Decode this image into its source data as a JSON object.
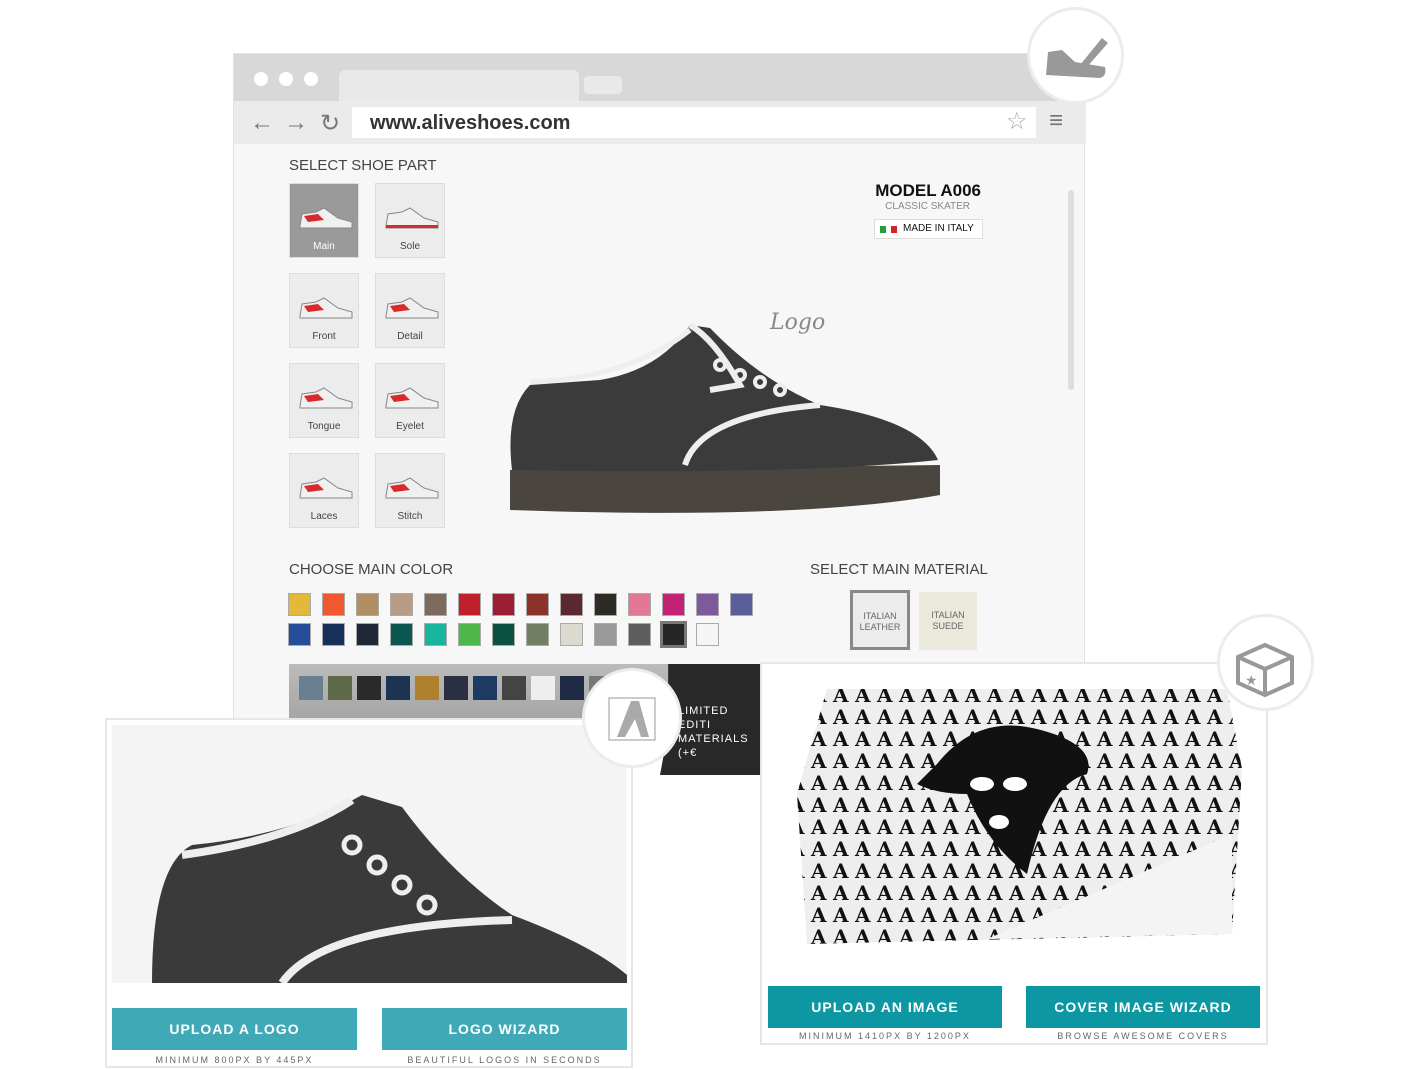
{
  "browser": {
    "url": "www.aliveshoes.com"
  },
  "shoe_parts": {
    "title": "SELECT SHOE PART",
    "items": [
      {
        "label": "Main",
        "selected": true
      },
      {
        "label": "Sole"
      },
      {
        "label": "Front"
      },
      {
        "label": "Detail"
      },
      {
        "label": "Tongue"
      },
      {
        "label": "Eyelet"
      },
      {
        "label": "Laces"
      },
      {
        "label": "Stitch"
      }
    ]
  },
  "model": {
    "title": "MODEL A006",
    "subtitle": "CLASSIC SKATER",
    "badge": "MADE IN ITALY"
  },
  "annotation": "Logo",
  "colors": {
    "title": "CHOOSE MAIN COLOR",
    "swatches": [
      "#e2b93a",
      "#f0592f",
      "#b08f64",
      "#b99c86",
      "#7e6a5c",
      "#c0202b",
      "#9a1f34",
      "#8c3228",
      "#5b2830",
      "#2e2b25",
      "#e07896",
      "#c22374",
      "#7e5a9a",
      "#5a5f9c",
      "#254d99",
      "#17305a",
      "#1f2837",
      "#0b5851",
      "#17b59d",
      "#4db74a",
      "#0b5040",
      "#727f63",
      "#dcd9cf",
      "#9a9a9a",
      "#5d5d5d",
      "#262626",
      "#f5f5f5"
    ],
    "selected_index": 25
  },
  "materials": {
    "title": "SELECT MAIN MATERIAL",
    "items": [
      {
        "label": "ITALIAN LEATHER",
        "selected": true
      },
      {
        "label": "ITALIAN SUEDE"
      }
    ]
  },
  "limited": {
    "line1": "LIMITED EDITI",
    "line2": "MATERIALS (+€"
  },
  "logo_card": {
    "buttons": [
      {
        "label": "UPLOAD A LOGO",
        "caption": "MINIMUM 800PX BY 445PX"
      },
      {
        "label": "LOGO WIZARD",
        "caption": "BEAUTIFUL LOGOS IN SECONDS"
      }
    ],
    "color": "#3fa9b8"
  },
  "cover_card": {
    "buttons": [
      {
        "label": "UPLOAD AN IMAGE",
        "caption": "MINIMUM 1410PX BY 1200PX"
      },
      {
        "label": "COVER IMAGE WIZARD",
        "caption": "BROWSE AWESOME COVERS"
      }
    ],
    "color": "#0d97a2"
  }
}
